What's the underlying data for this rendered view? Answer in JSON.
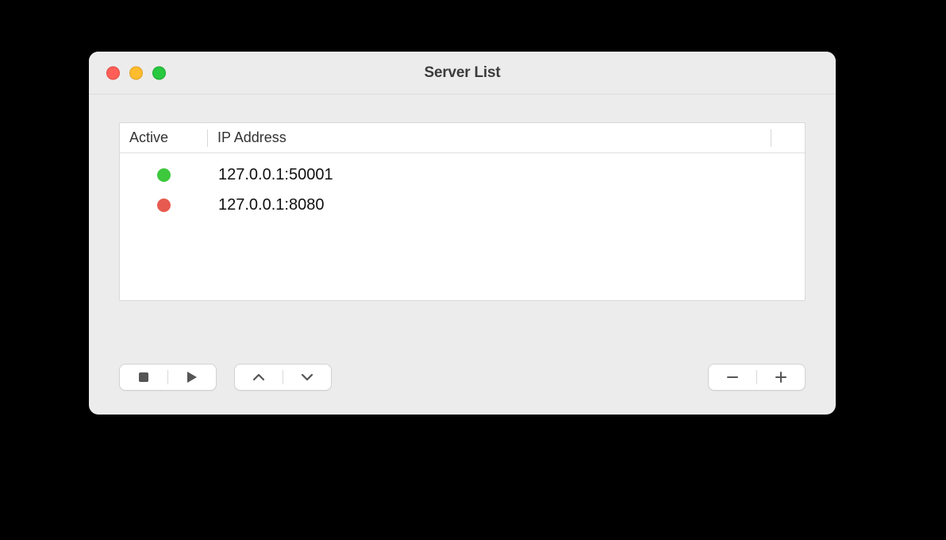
{
  "window": {
    "title": "Server List"
  },
  "table": {
    "headers": {
      "active": "Active",
      "ip": "IP Address"
    },
    "rows": [
      {
        "status": "green",
        "ip": "127.0.0.1:50001"
      },
      {
        "status": "red",
        "ip": "127.0.0.1:8080"
      }
    ]
  },
  "colors": {
    "status_green": "#3dc83d",
    "status_red": "#e75a4f"
  }
}
